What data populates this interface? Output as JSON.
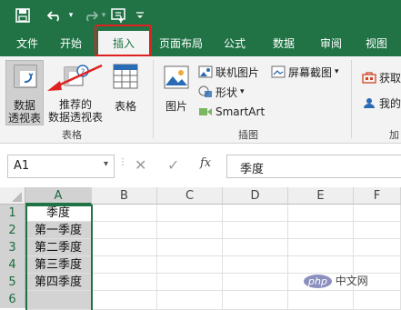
{
  "tabs": [
    "文件",
    "开始",
    "插入",
    "页面布局",
    "公式",
    "数据",
    "审阅",
    "视图"
  ],
  "active_tab": "插入",
  "ribbon": {
    "pivot_table": "数据\n透视表",
    "pivot_line1": "数据",
    "pivot_line2": "透视表",
    "recommended_line1": "推荐的",
    "recommended_line2": "数据透视表",
    "table": "表格",
    "group_tables": "表格",
    "picture": "图片",
    "online_pictures": "联机图片",
    "shapes": "形状",
    "smartart": "SmartArt",
    "screenshot": "屏幕截图",
    "group_illustrations": "插图",
    "get_addins": "获取",
    "my_addins": "我的",
    "group_addins": "加"
  },
  "formula_bar": {
    "name_box": "A1",
    "fx": "fx",
    "content": "季度"
  },
  "columns": [
    "A",
    "B",
    "C",
    "D",
    "E",
    "F"
  ],
  "rows": [
    {
      "num": "1",
      "a": "季度"
    },
    {
      "num": "2",
      "a": "第一季度"
    },
    {
      "num": "3",
      "a": "第二季度"
    },
    {
      "num": "4",
      "a": "第三季度"
    },
    {
      "num": "5",
      "a": "第四季度"
    },
    {
      "num": "6",
      "a": ""
    }
  ],
  "watermark": "php 中文网",
  "colors": {
    "excel_green": "#217346",
    "highlight_red": "#e02020"
  }
}
